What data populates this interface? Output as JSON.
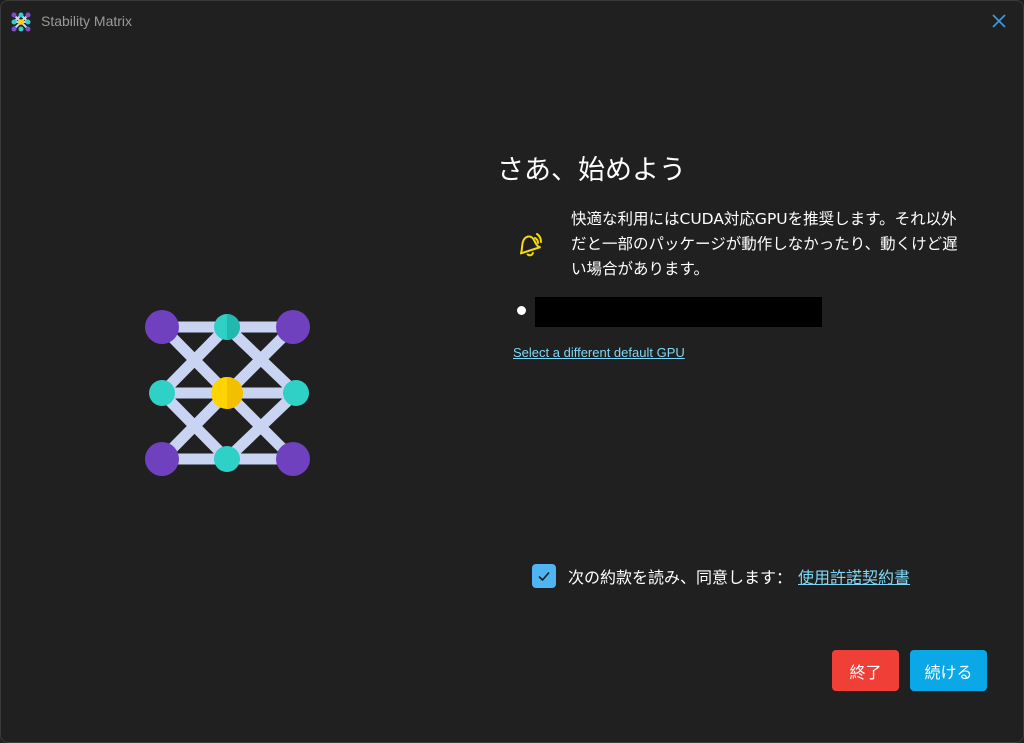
{
  "window": {
    "title": "Stability Matrix"
  },
  "main": {
    "heading": "さあ、始めよう",
    "warning_text": "快適な利用にはCUDA対応GPUを推奨します。それ以外だと一部のパッケージが動作しなかったり、動くけど遅い場合があります。",
    "gpu_link": "Select a different default GPU"
  },
  "agreement": {
    "checked": true,
    "text": "次の約款を読み、同意します：",
    "link": "使用許諾契約書"
  },
  "buttons": {
    "quit": "終了",
    "continue": "続ける"
  },
  "colors": {
    "background": "#202020",
    "accent_link": "#7fd7f5",
    "checkbox": "#4fb5f2",
    "quit_button": "#ef3f37",
    "continue_button": "#0ba8e8",
    "warning_icon": "#f5d90a"
  },
  "icons": {
    "app_logo": "stability-matrix-logo-icon",
    "close": "close-icon",
    "warning": "bell-alert-icon",
    "check": "checkmark-icon"
  }
}
